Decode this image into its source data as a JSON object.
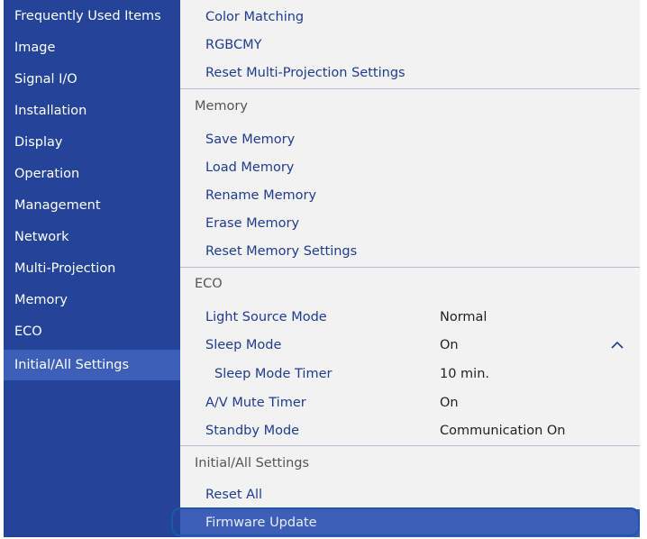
{
  "sidebar": {
    "items": [
      {
        "label": "Frequently Used Items"
      },
      {
        "label": "Image"
      },
      {
        "label": "Signal I/O"
      },
      {
        "label": "Installation"
      },
      {
        "label": "Display"
      },
      {
        "label": "Operation"
      },
      {
        "label": "Management"
      },
      {
        "label": "Network"
      },
      {
        "label": "Multi-Projection"
      },
      {
        "label": "Memory"
      },
      {
        "label": "ECO"
      },
      {
        "label": "Initial/All Settings",
        "selected": true
      }
    ]
  },
  "panel": {
    "multi_projection": [
      {
        "label": "Color Matching"
      },
      {
        "label": "RGBCMY"
      },
      {
        "label": "Reset Multi-Projection Settings"
      }
    ],
    "memory_header": "Memory",
    "memory": [
      {
        "label": "Save Memory"
      },
      {
        "label": "Load Memory"
      },
      {
        "label": "Rename Memory"
      },
      {
        "label": "Erase Memory"
      },
      {
        "label": "Reset Memory Settings"
      }
    ],
    "eco_header": "ECO",
    "eco": [
      {
        "label": "Light Source Mode",
        "value": "Normal"
      },
      {
        "label": "Sleep Mode",
        "value": "On",
        "expanded": true
      },
      {
        "label": "Sleep Mode Timer",
        "value": "10 min."
      },
      {
        "label": "A/V Mute Timer",
        "value": "On"
      },
      {
        "label": "Standby Mode",
        "value": "Communication On"
      }
    ],
    "initial_header": "Initial/All Settings",
    "initial": [
      {
        "label": "Reset All"
      },
      {
        "label": "Firmware Update",
        "selected": true
      }
    ]
  },
  "colors": {
    "sidebar_bg": "#24449a",
    "selection": "#3d5fb8",
    "panel_bg": "#f2f2f2",
    "link_text": "#1f3d90",
    "focus_ring": "#1a5aa8"
  },
  "icons": {
    "sleep_mode_toggle": "chevron-up-icon"
  }
}
